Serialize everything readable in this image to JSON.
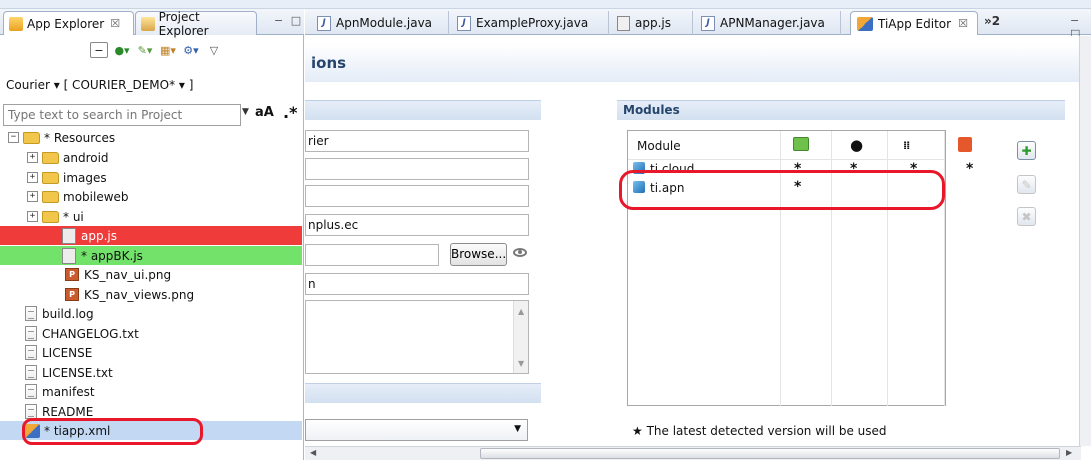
{
  "left_panel": {
    "tabs": [
      {
        "label": "App Explorer",
        "close": "☒"
      },
      {
        "label": "Project Explorer"
      }
    ],
    "window_controls": "− □",
    "project_selector": "Courier  ▾ [ COURIER_DEMO*  ▾ ]",
    "search_placeholder": "Type text to search in Project",
    "case_toggle": "aA",
    "regex_toggle": ".*",
    "tree": [
      {
        "label": "* Resources",
        "expander": "−"
      },
      {
        "label": "android",
        "expander": "+"
      },
      {
        "label": "images",
        "expander": "+"
      },
      {
        "label": "mobileweb",
        "expander": "+"
      },
      {
        "label": "* ui",
        "expander": "+"
      },
      {
        "label": "app.js"
      },
      {
        "label": "* appBK.js"
      },
      {
        "label": "KS_nav_ui.png"
      },
      {
        "label": "KS_nav_views.png"
      },
      {
        "label": "build.log"
      },
      {
        "label": "CHANGELOG.txt"
      },
      {
        "label": "LICENSE"
      },
      {
        "label": "LICENSE.txt"
      },
      {
        "label": "manifest"
      },
      {
        "label": "README"
      },
      {
        "label": "* tiapp.xml"
      }
    ]
  },
  "editor": {
    "tabs": [
      {
        "label": "ApnModule.java"
      },
      {
        "label": "ExampleProxy.java"
      },
      {
        "label": "app.js"
      },
      {
        "label": "APNManager.java"
      },
      {
        "label": "TiApp Editor",
        "close": "☒"
      }
    ],
    "overflow_label": "»2",
    "page_title": "ions",
    "fields": [
      "rier",
      "",
      "",
      "nplus.ec",
      "",
      "n"
    ],
    "browse_label": "Browse...",
    "modules": {
      "section_title": "Modules",
      "column_header": "Module",
      "rows": [
        {
          "name": "ti.cloud",
          "marks": [
            "*",
            "*",
            "*",
            "*"
          ]
        },
        {
          "name": "ti.apn",
          "marks": [
            "*",
            "",
            "",
            ""
          ]
        }
      ],
      "footnote": "★  The latest detected version will be used"
    }
  },
  "colors": {
    "highlight_red": "#f03b3b",
    "highlight_green": "#73e26b",
    "selection_blue": "#c3d9f3",
    "annotation_red": "#e8182a"
  }
}
